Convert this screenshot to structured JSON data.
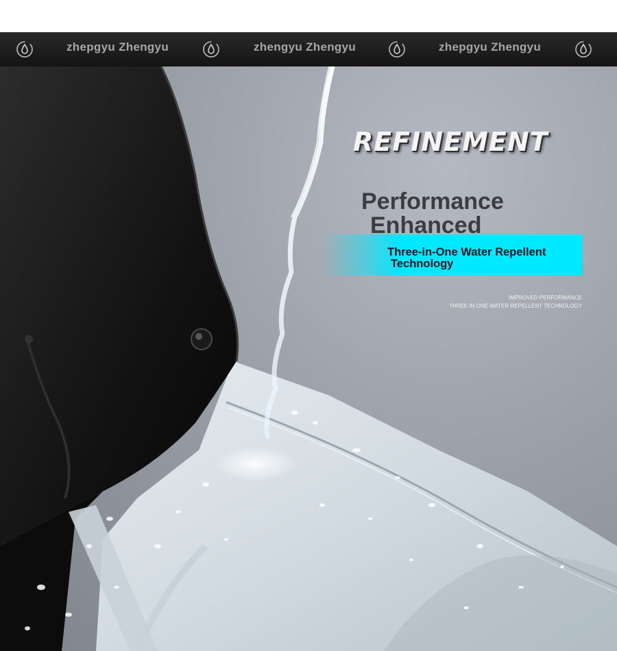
{
  "brand_bar": {
    "labels": [
      "zhepgyu Zhengyu",
      "zhengyu Zhengyu",
      "zhepgyu Zhengyu"
    ],
    "icon": "water-drop-icon",
    "background_color": "#1a1a1a",
    "text_color": "#a6a6a6"
  },
  "hero": {
    "headline": "REFINEMENT",
    "performance_line1": "Performance",
    "performance_line2": "Enhanced",
    "band_line1": "Three-in-One Water Repellent",
    "band_line2": "Technology",
    "band_color": "#00eaff",
    "small_line1": "IMPROVED PERFORMANCE",
    "small_line2": "THREE IN ONE WATER REPELLENT TECHNOLOGY"
  }
}
